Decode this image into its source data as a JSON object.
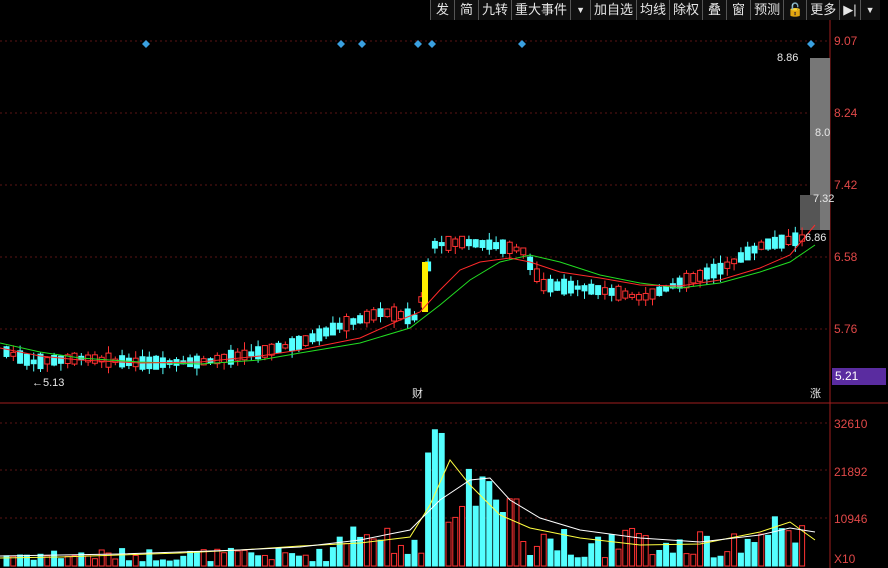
{
  "toolbar": {
    "items": [
      "发",
      "简",
      "九转",
      "重大事件",
      "▼",
      "加自选",
      "均线",
      "除权",
      "叠",
      "窗",
      "预测",
      "🔓",
      "更多",
      "▶|",
      "▼"
    ]
  },
  "price_axis": {
    "labels": [
      "9.07",
      "8.24",
      "7.42",
      "6.58",
      "5.76",
      "5.21"
    ]
  },
  "volume_axis": {
    "labels": [
      "32610",
      "21892",
      "10946"
    ],
    "unit": "X10"
  },
  "annotations": {
    "high_label": "8.86",
    "low_label": "←5.13",
    "forecast_1": "8.0",
    "forecast_2": "7.32",
    "forecast_3": "6.86",
    "marker_cai": "财",
    "marker_zhang": "涨",
    "current_price": "5.21"
  },
  "colors": {
    "up": "#ff3232",
    "down": "#54ffff",
    "ma_short": "#ff2a2a",
    "ma_long": "#22dd22",
    "vol_ma1": "#ffffff",
    "vol_ma2": "#ffff40",
    "diamond": "#3aa0e0",
    "highlight": "#ffee00",
    "forecast_bar": "#777777",
    "price_tag": "#5a2ca0",
    "axis_text": "#e04848"
  },
  "chart_data": {
    "type": "candlestick",
    "y_axis_ticks": [
      9.07,
      8.24,
      7.42,
      6.58,
      5.76
    ],
    "volume_axis_ticks": [
      32610,
      21892,
      10946
    ],
    "volume_unit": "X10",
    "annotations": [
      "8.86",
      "5.13",
      "6.86",
      "7.32",
      "8.0"
    ]
  }
}
